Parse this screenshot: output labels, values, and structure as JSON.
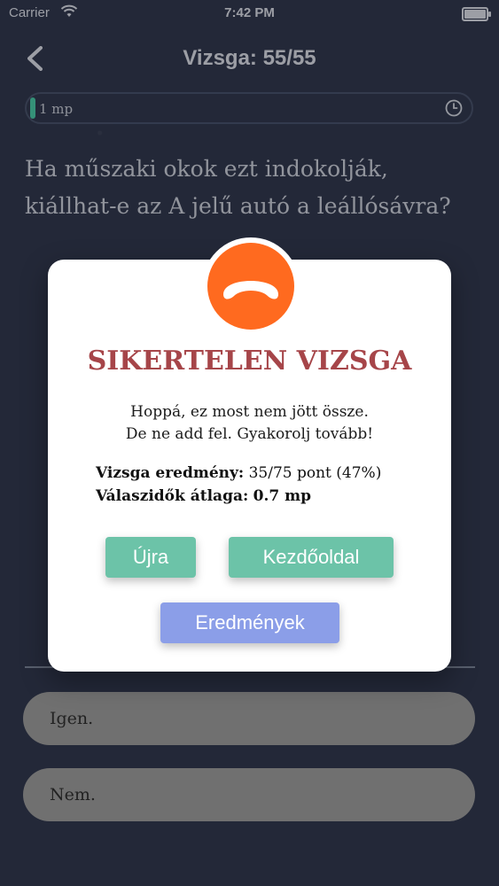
{
  "status_bar": {
    "carrier": "Carrier",
    "time": "7:42 PM"
  },
  "nav": {
    "title": "Vizsga: 55/55"
  },
  "timer": {
    "label": "1 mp",
    "progress": 0.01
  },
  "question": {
    "text": "Ha műszaki okok ezt indokolják, kiállhat-e az A jelű autó a leállósávra?"
  },
  "answers": [
    {
      "label": "Igen."
    },
    {
      "label": "Nem."
    }
  ],
  "modal": {
    "title": "SIKERTELEN VIZSGA",
    "message_line1": "Hoppá, ez most nem jött össze.",
    "message_line2": "De ne add fel. Gyakorolj tovább!",
    "score_label": "Vizsga eredmény:",
    "score_value": "35/75 pont (47%)",
    "avg_label": "Válaszidők átlaga:",
    "avg_value": "0.7 mp",
    "retry_button": "Újra",
    "home_button": "Kezdőoldal",
    "results_button": "Eredmények"
  },
  "colors": {
    "background": "#232838",
    "accent_green": "#6cc3a8",
    "accent_blue": "#8b9ee8",
    "fail_red": "#a64549",
    "sad_face_orange": "#ff6a1f",
    "answer_pill": "#707070"
  }
}
